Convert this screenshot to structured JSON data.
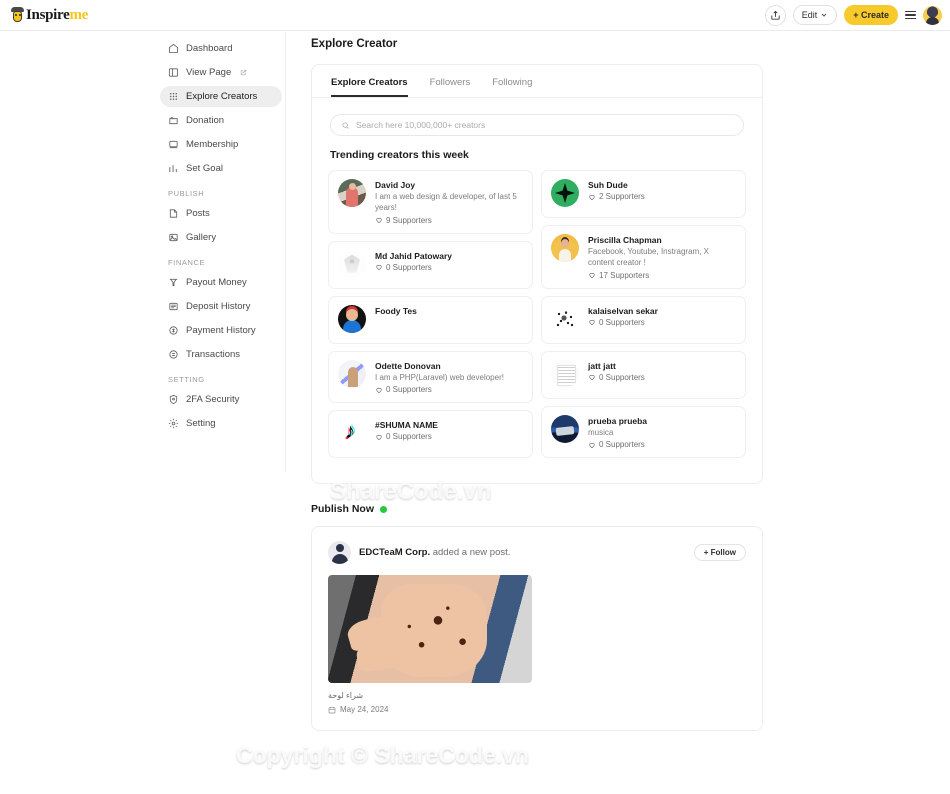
{
  "topbar": {
    "logo_primary": "Inspire",
    "logo_accent": "me",
    "share_icon": "share-icon",
    "edit_label": "Edit",
    "create_label": "+ Create",
    "menu_icon": "hamburger-menu-icon",
    "avatar_icon": "user-avatar"
  },
  "sidebar": {
    "items": [
      {
        "label": "Dashboard",
        "icon": "home-icon",
        "active": false,
        "external": false
      },
      {
        "label": "View Page",
        "icon": "layout-icon",
        "active": false,
        "external": true
      },
      {
        "label": "Explore Creators",
        "icon": "grid-dots-icon",
        "active": true,
        "external": false
      },
      {
        "label": "Donation",
        "icon": "donation-icon",
        "active": false,
        "external": false
      },
      {
        "label": "Membership",
        "icon": "membership-card-icon",
        "active": false,
        "external": false
      },
      {
        "label": "Set Goal",
        "icon": "bar-chart-icon",
        "active": false,
        "external": false
      }
    ],
    "group_publish": "PUBLISH",
    "publish_items": [
      {
        "label": "Posts",
        "icon": "posts-icon"
      },
      {
        "label": "Gallery",
        "icon": "gallery-image-icon"
      }
    ],
    "group_finance": "FINANCE",
    "finance_items": [
      {
        "label": "Payout Money",
        "icon": "payout-icon"
      },
      {
        "label": "Deposit History",
        "icon": "deposit-icon"
      },
      {
        "label": "Payment History",
        "icon": "payment-history-icon"
      },
      {
        "label": "Transactions",
        "icon": "transactions-icon"
      }
    ],
    "group_setting": "SETTING",
    "setting_items": [
      {
        "label": "2FA Security",
        "icon": "shield-lock-icon"
      },
      {
        "label": "Setting",
        "icon": "gear-icon"
      }
    ]
  },
  "main": {
    "page_title": "Explore Creator",
    "tabs": [
      {
        "label": "Explore Creators",
        "active": true
      },
      {
        "label": "Followers",
        "active": false
      },
      {
        "label": "Following",
        "active": false
      }
    ],
    "search": {
      "placeholder": "Search here 10,000,000+ creators",
      "value": "",
      "icon": "search-icon"
    },
    "section_title": "Trending creators this week",
    "creators_left": [
      {
        "name": "David Joy",
        "bio": "I am a web design & developer, of last 5 years!",
        "supporters": "9 Supporters",
        "avatar": "av-david"
      },
      {
        "name": "Md Jahid Patowary",
        "bio": "",
        "supporters": "0 Supporters",
        "avatar": "av-jahid"
      },
      {
        "name": "Foody Tes",
        "bio": "",
        "supporters": "",
        "avatar": "av-foody"
      },
      {
        "name": "Odette Donovan",
        "bio": "I am a PHP(Laravel) web developer!",
        "supporters": "0 Supporters",
        "avatar": "av-odette"
      },
      {
        "name": "#SHUMA NAME",
        "bio": "",
        "supporters": "0 Supporters",
        "avatar": "av-tiktok"
      }
    ],
    "creators_right": [
      {
        "name": "Suh Dude",
        "bio": "",
        "supporters": "2 Supporters",
        "avatar": "av-suh"
      },
      {
        "name": "Priscilla Chapman",
        "bio": "Facebook, Youtube, Instragram, X content creator !",
        "supporters": "17 Supporters",
        "avatar": "av-pris"
      },
      {
        "name": "kalaiselvan sekar",
        "bio": "",
        "supporters": "0 Supporters",
        "avatar": "av-kalai"
      },
      {
        "name": "jatt jatt",
        "bio": "",
        "supporters": "0 Supporters",
        "avatar": "av-jatt"
      },
      {
        "name": "prueba prueba",
        "bio": "musica",
        "supporters": "0 Supporters",
        "avatar": "av-prueba"
      }
    ]
  },
  "publish": {
    "heading": "Publish Now",
    "status_dot_color": "#27c93f",
    "post": {
      "author": "EDCTeaM Corp.",
      "action": " added a new post.",
      "follow_label": "+ Follow",
      "caption": "شراء لوحة",
      "date": "May 24, 2024",
      "media": "henna-tattoo-hand-photo"
    }
  },
  "watermarks": {
    "brand_green": "SHARE",
    "brand_grey": "CODE.vn",
    "center": "ShareCode.vn",
    "copyright": "Copyright © ShareCode.vn"
  }
}
